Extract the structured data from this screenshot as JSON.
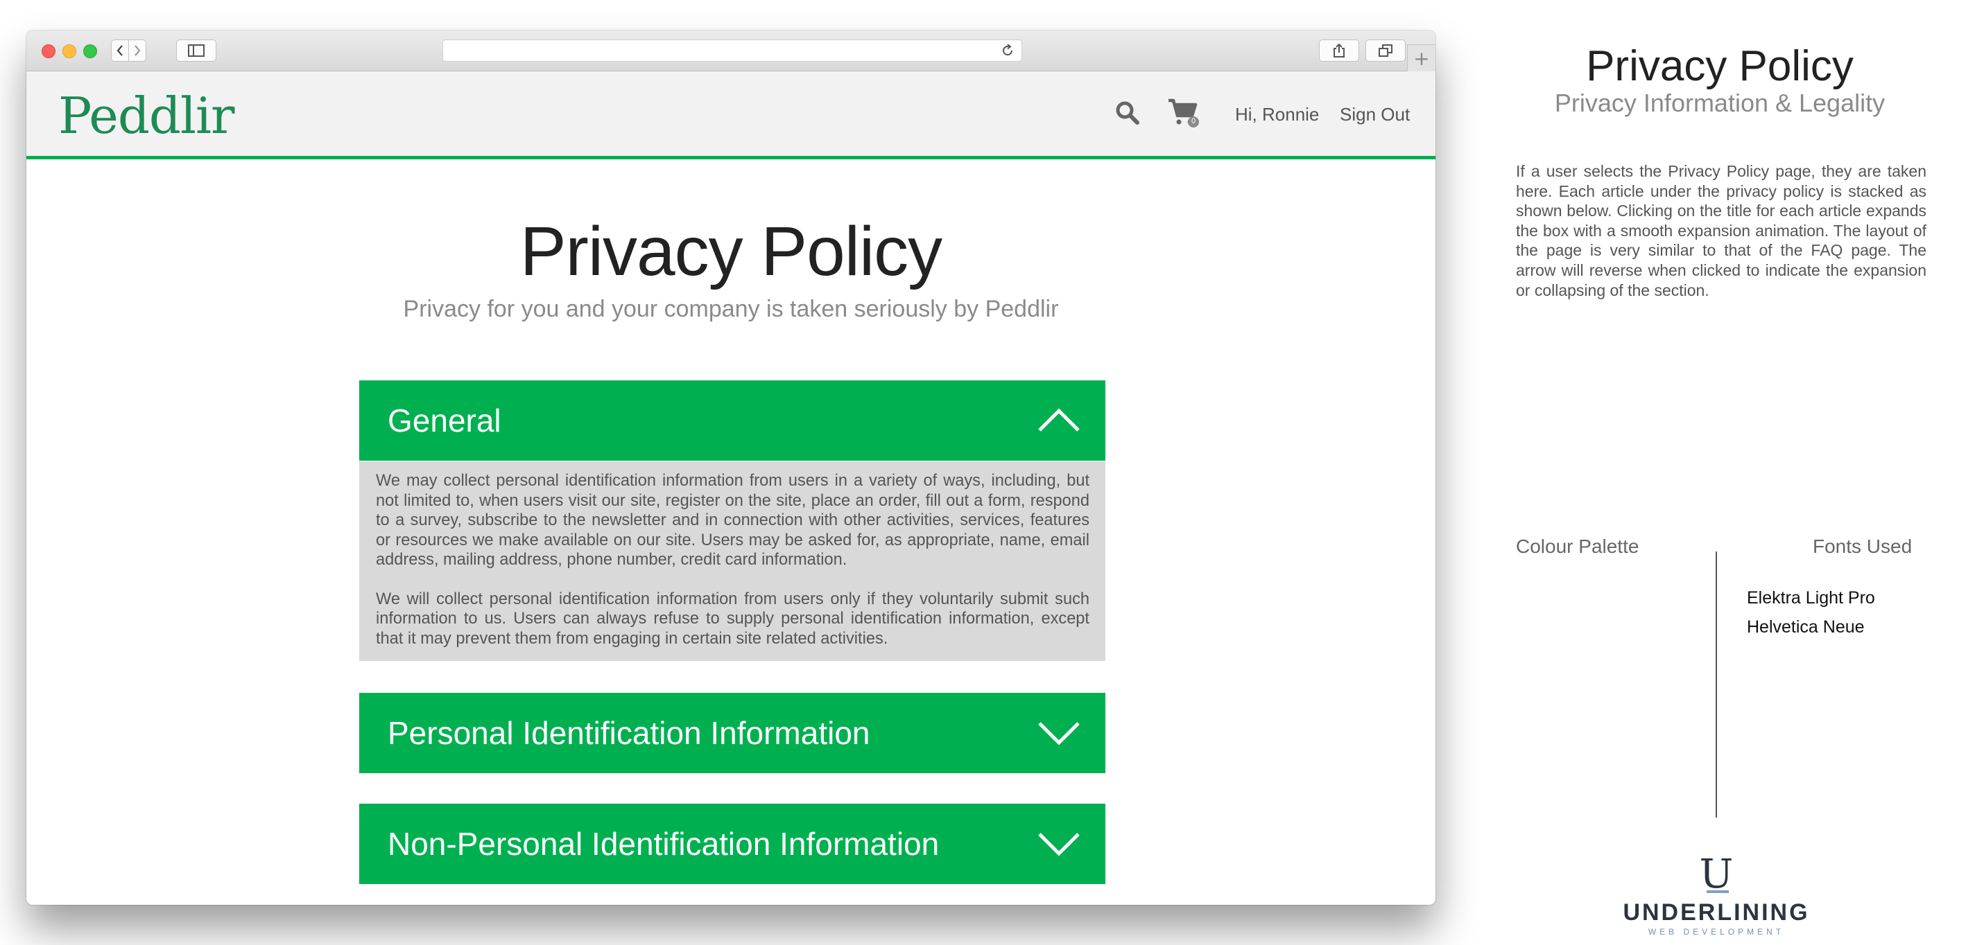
{
  "browser": {
    "address_text": ""
  },
  "site": {
    "logo": "Peddlir",
    "nav": {
      "greeting": "Hi, Ronnie",
      "sign_out": "Sign Out",
      "cart_count": "0"
    }
  },
  "page": {
    "title": "Privacy Policy",
    "subtitle": "Privacy for you and your company is taken seriously by Peddlir",
    "sections": [
      {
        "title": "General",
        "expanded": true,
        "paragraphs": [
          "We may collect personal identification information from users in a variety of ways, including, but not limited to, when users visit our site, register on the site, place an order, fill out a form, respond to a survey, subscribe to the newsletter and in connection with other activities, services, features or resources we make available on our site. Users may be asked for, as appropriate, name, email address, mailing address, phone number, credit card information.",
          "We will collect personal identification information from users only if they voluntarily submit such information to us. Users can always refuse to supply personal identification information, except that it may prevent them from engaging in certain site related activities."
        ]
      },
      {
        "title": "Personal Identification Information",
        "expanded": false
      },
      {
        "title": "Non-Personal Identification Information",
        "expanded": false
      }
    ]
  },
  "spec": {
    "title": "Privacy Policy",
    "subtitle": "Privacy Information & Legality",
    "description": "If a user selects the Privacy Policy page, they are taken here.  Each article under the privacy policy is stacked as shown below.  Clicking on the title for each article expands the box with a smooth expansion animation.  The layout of the page is very similar to that of the FAQ page.  The arrow will reverse when clicked to indicate the expansion or collapsing of the section.",
    "palette_label": "Colour Palette",
    "fonts_label": "Fonts Used",
    "fonts": [
      "Elektra Light Pro",
      "Helvetica Neue"
    ],
    "brand": {
      "mark": "U",
      "name": "UNDERLINING",
      "tagline": "WEB DEVELOPMENT"
    }
  },
  "colors": {
    "accent_green": "#00b050",
    "logo_green": "#1e8a55",
    "panel_grey": "#d9d9d9"
  },
  "icons": [
    "search-icon",
    "cart-icon",
    "chevron-up-icon",
    "chevron-down-icon",
    "share-icon",
    "tabs-icon",
    "sidebar-icon",
    "reload-icon"
  ]
}
